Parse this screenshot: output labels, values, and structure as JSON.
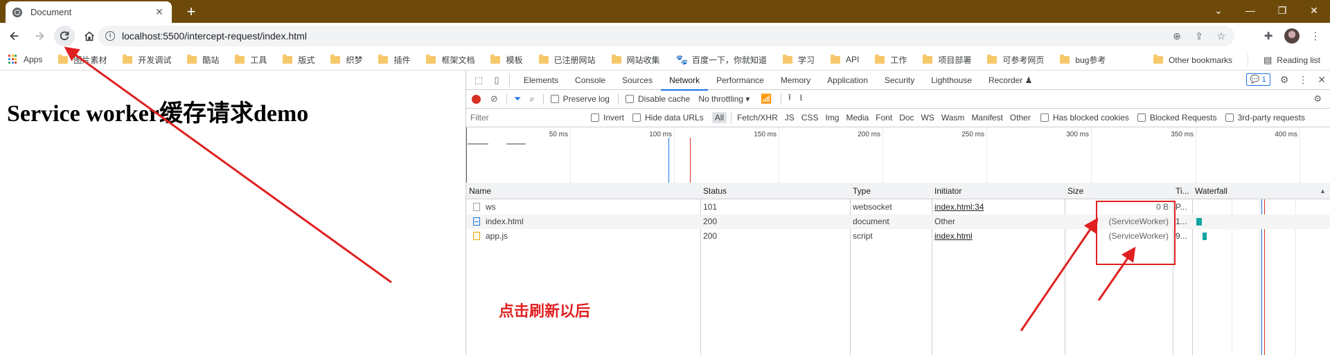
{
  "browser": {
    "tab_title": "Document",
    "tab_close": "✕",
    "new_tab": "+",
    "url": "localhost:5500/intercept-request/index.html",
    "window_controls": [
      "⌄",
      "—",
      "❐",
      "✕"
    ]
  },
  "bookmarks": {
    "items": [
      "Apps",
      "图片素材",
      "开发调试",
      "酷站",
      "工具",
      "版式",
      "织梦",
      "插件",
      "框架文档",
      "模板",
      "已注册网站",
      "网站收集",
      "百度一下，你就知道",
      "学习",
      "API",
      "工作",
      "项目部署",
      "可参考网页",
      "bug参考"
    ],
    "other": "Other bookmarks",
    "reading": "Reading list",
    "apps_colors": [
      "#ea4335",
      "#fbbc04",
      "#34a853",
      "#4285f4",
      "#ea4335",
      "#fbbc04",
      "#34a853",
      "#4285f4",
      "#ea4335"
    ]
  },
  "page": {
    "heading": "Service worker缓存请求demo"
  },
  "devtools": {
    "tabs": [
      "Elements",
      "Console",
      "Sources",
      "Network",
      "Performance",
      "Memory",
      "Application",
      "Security",
      "Lighthouse",
      "Recorder ♟"
    ],
    "active_tab": "Network",
    "issues_badge": "💬 1",
    "toolbar": {
      "preserve_log": "Preserve log",
      "disable_cache": "Disable cache",
      "throttling": "No throttling ▾"
    },
    "filter": {
      "placeholder": "Filter",
      "invert": "Invert",
      "hide_data_urls": "Hide data URLs",
      "types": [
        "All",
        "Fetch/XHR",
        "JS",
        "CSS",
        "Img",
        "Media",
        "Font",
        "Doc",
        "WS",
        "Wasm",
        "Manifest",
        "Other"
      ],
      "active_type": "All",
      "has_blocked_cookies": "Has blocked cookies",
      "blocked_requests": "Blocked Requests",
      "third_party": "3rd-party requests"
    },
    "overview_ticks": [
      "50 ms",
      "100 ms",
      "150 ms",
      "200 ms",
      "250 ms",
      "300 ms",
      "350 ms",
      "400 ms"
    ],
    "columns": [
      "Name",
      "Status",
      "Type",
      "Initiator",
      "Size",
      "Ti...",
      "Waterfall"
    ],
    "rows": [
      {
        "name": "ws",
        "status": "101",
        "type": "websocket",
        "initiator": "index.html:34",
        "size": "0 B",
        "time": "P..."
      },
      {
        "name": "index.html",
        "status": "200",
        "type": "document",
        "initiator": "Other",
        "size": "(ServiceWorker)",
        "time": "1..."
      },
      {
        "name": "app.js",
        "status": "200",
        "type": "script",
        "initiator": "index.html",
        "size": "(ServiceWorker)",
        "time": "9..."
      }
    ]
  },
  "annotation": {
    "text": "点击刷新以后",
    "color": "#e02020"
  }
}
